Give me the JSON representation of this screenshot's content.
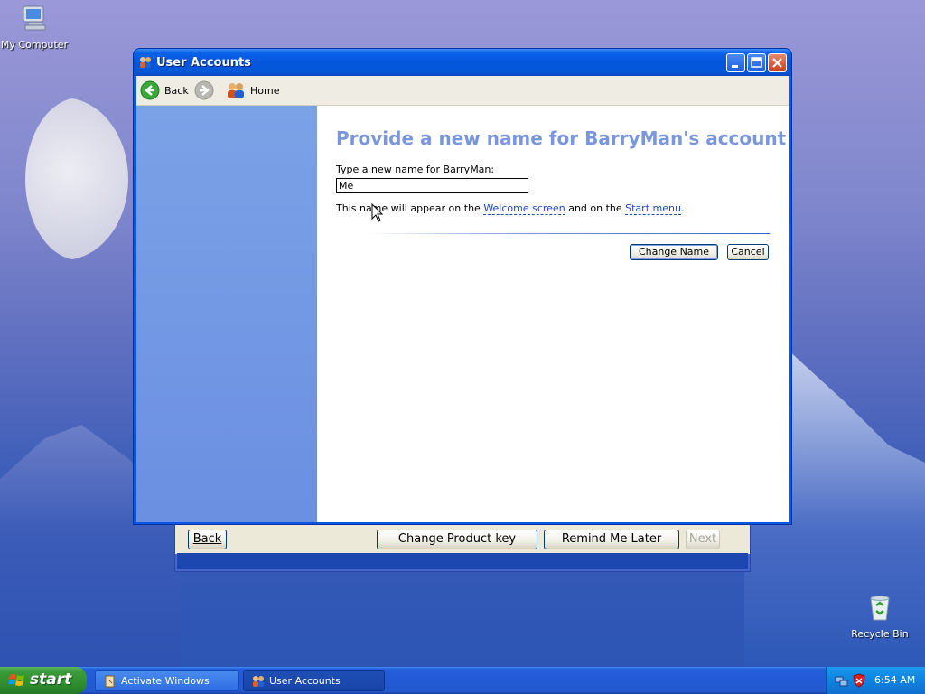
{
  "desktop": {
    "icons": [
      {
        "label": "My Computer"
      },
      {
        "label": "Recycle Bin"
      }
    ]
  },
  "background_dialog": {
    "back_label": "Back",
    "change_key_label": "Change Product key",
    "remind_label": "Remind Me Later",
    "next_label": "Next"
  },
  "window": {
    "title": "User Accounts",
    "toolbar": {
      "back_label": "Back",
      "home_label": "Home"
    },
    "content": {
      "heading": "Provide a new name for BarryMan's account",
      "field_label": "Type a new name for BarryMan:",
      "field_value": "Me",
      "info_prefix": "This name will appear on the ",
      "info_link1": "Welcome screen",
      "info_middle": " and on the ",
      "info_link2": "Start menu",
      "info_suffix": ".",
      "change_name_label": "Change Name",
      "cancel_label": "Cancel"
    }
  },
  "taskbar": {
    "start_label": "start",
    "tasks": [
      {
        "label": "Activate Windows"
      },
      {
        "label": "User Accounts"
      }
    ],
    "clock": "6:54 AM"
  },
  "colors": {
    "heading": "#7a96df",
    "link": "#1c49c0",
    "titlebar": "#0555dc",
    "left_pane": "#7ba2e7"
  }
}
